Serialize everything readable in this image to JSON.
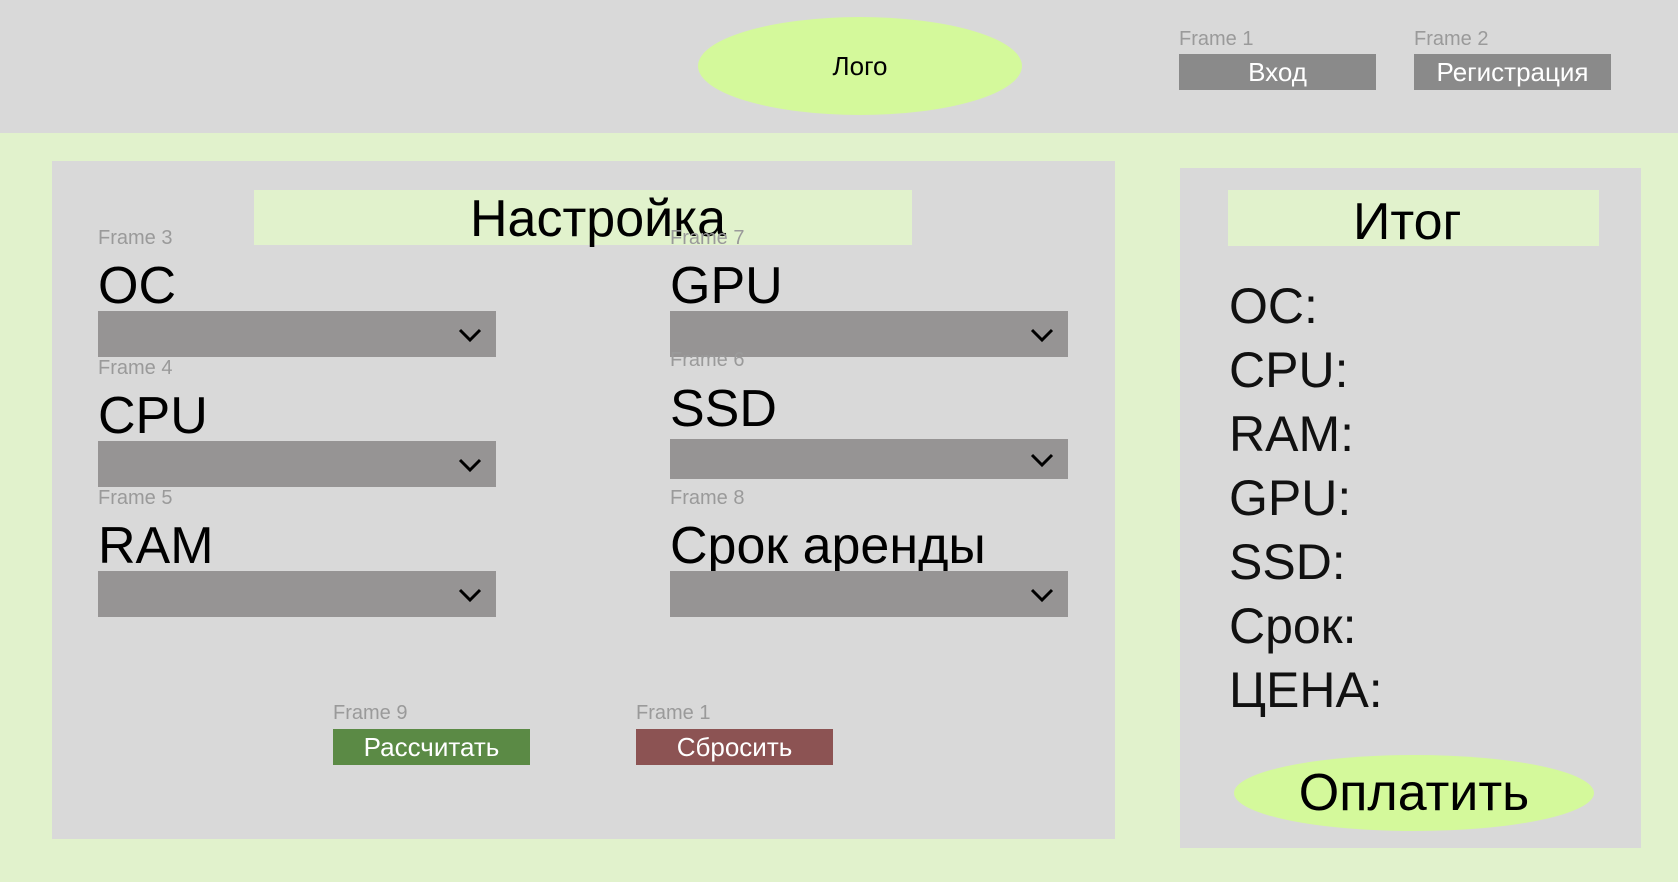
{
  "header": {
    "logo": "Лого",
    "login_frame": "Frame 1",
    "login_label": "Вход",
    "register_frame": "Frame 2",
    "register_label": "Регистрация"
  },
  "config": {
    "title": "Настройка",
    "fields": [
      {
        "frame": "Frame 3",
        "label": "ОС",
        "value": ""
      },
      {
        "frame": "Frame 4",
        "label": "CPU",
        "value": ""
      },
      {
        "frame": "Frame 5",
        "label": "RAM",
        "value": ""
      },
      {
        "frame": "Frame 7",
        "label": "GPU",
        "value": ""
      },
      {
        "frame": "Frame 6",
        "label": "SSD",
        "value": ""
      },
      {
        "frame": "Frame 8",
        "label": "Срок аренды",
        "value": ""
      }
    ],
    "calculate_frame": "Frame 9",
    "calculate_label": "Рассчитать",
    "reset_frame": "Frame 1",
    "reset_label": "Сбросить"
  },
  "summary": {
    "title": "Итог",
    "lines": [
      "ОС:",
      "CPU:",
      "RAM:",
      "GPU:",
      "SSD:",
      "Срок:",
      "ЦЕНА:"
    ],
    "pay_label": "Оплатить"
  },
  "colors": {
    "header_bg": "#d9d9d9",
    "page_bg": "#e1f2cc",
    "accent_green": "#d4f99b",
    "calculate_bg": "#5b8a45",
    "reset_bg": "#8c5353",
    "select_bg": "#969494"
  },
  "icons": {
    "dropdown": "chevron-down-icon"
  }
}
